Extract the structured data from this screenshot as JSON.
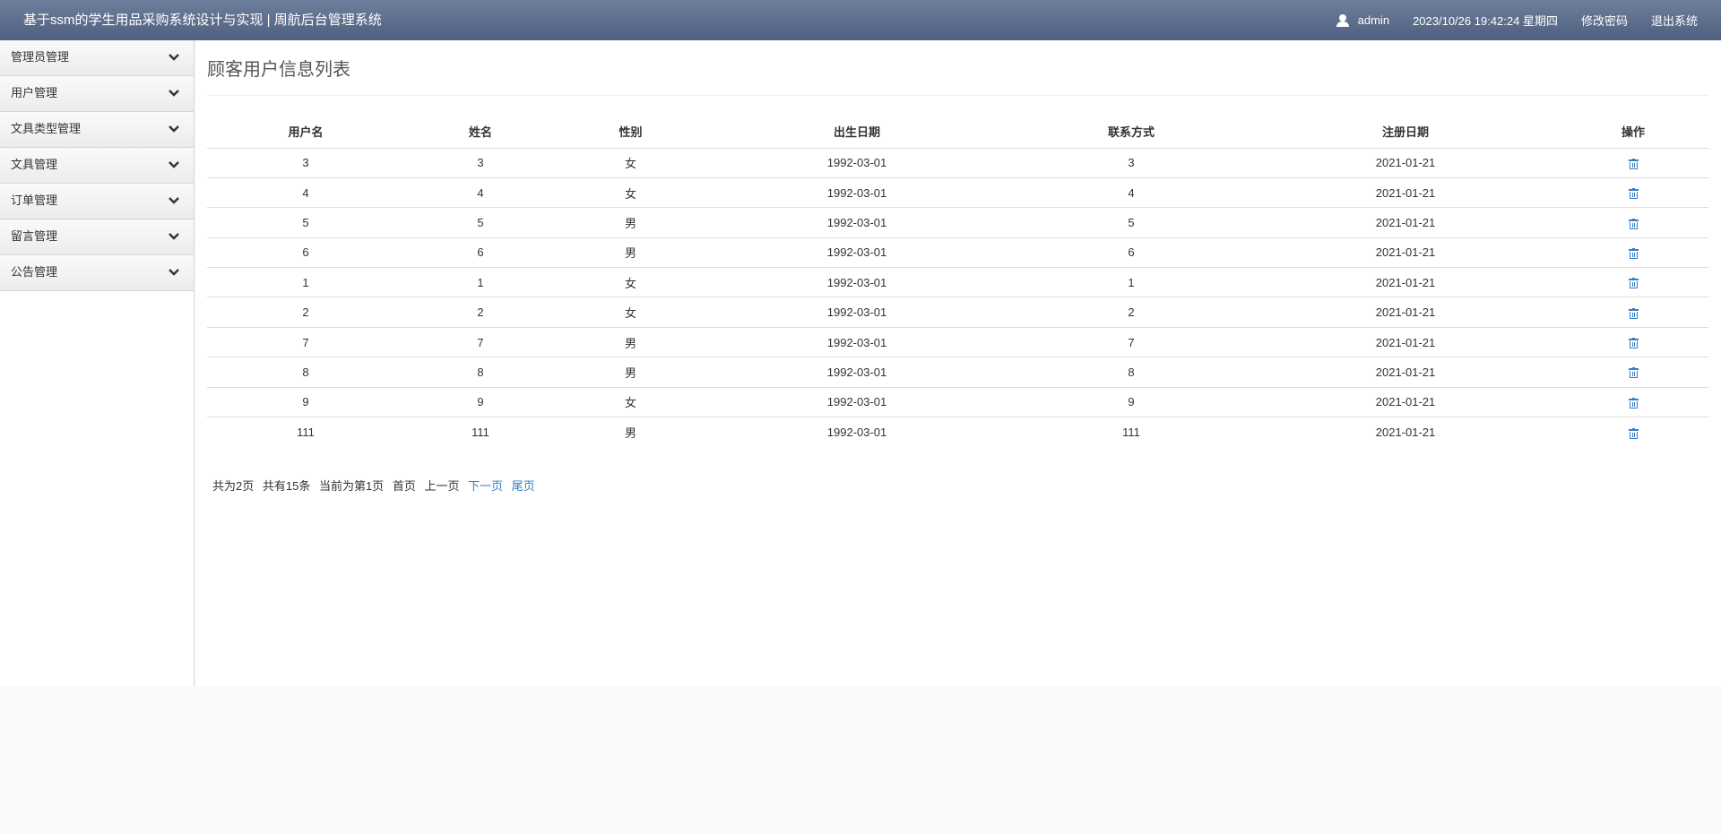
{
  "header": {
    "title": "基于ssm的学生用品采购系统设计与实现 | 周航后台管理系统",
    "username": "admin",
    "datetime": "2023/10/26 19:42:24 星期四",
    "change_password": "修改密码",
    "logout": "退出系统"
  },
  "sidebar": {
    "items": [
      {
        "label": "管理员管理"
      },
      {
        "label": "用户管理"
      },
      {
        "label": "文具类型管理"
      },
      {
        "label": "文具管理"
      },
      {
        "label": "订单管理"
      },
      {
        "label": "留言管理"
      },
      {
        "label": "公告管理"
      }
    ]
  },
  "main": {
    "page_title": "顾客用户信息列表",
    "table": {
      "headers": [
        "用户名",
        "姓名",
        "性别",
        "出生日期",
        "联系方式",
        "注册日期",
        "操作"
      ],
      "rows": [
        [
          "3",
          "3",
          "女",
          "1992-03-01",
          "3",
          "2021-01-21"
        ],
        [
          "4",
          "4",
          "女",
          "1992-03-01",
          "4",
          "2021-01-21"
        ],
        [
          "5",
          "5",
          "男",
          "1992-03-01",
          "5",
          "2021-01-21"
        ],
        [
          "6",
          "6",
          "男",
          "1992-03-01",
          "6",
          "2021-01-21"
        ],
        [
          "1",
          "1",
          "女",
          "1992-03-01",
          "1",
          "2021-01-21"
        ],
        [
          "2",
          "2",
          "女",
          "1992-03-01",
          "2",
          "2021-01-21"
        ],
        [
          "7",
          "7",
          "男",
          "1992-03-01",
          "7",
          "2021-01-21"
        ],
        [
          "8",
          "8",
          "男",
          "1992-03-01",
          "8",
          "2021-01-21"
        ],
        [
          "9",
          "9",
          "女",
          "1992-03-01",
          "9",
          "2021-01-21"
        ],
        [
          "111",
          "111",
          "男",
          "1992-03-01",
          "111",
          "2021-01-21"
        ]
      ],
      "action_icon": "trash-icon"
    },
    "pager": {
      "total_pages": "共为2页",
      "total_records": "共有15条",
      "current_page": "当前为第1页",
      "first": "首页",
      "prev": "上一页",
      "next": "下一页",
      "last": "尾页",
      "link_color": "#3a7dc1"
    }
  },
  "colors": {
    "header_top": "#6e7f9e",
    "header_bottom": "#4f5f7e",
    "accent": "#3a7dc1"
  }
}
